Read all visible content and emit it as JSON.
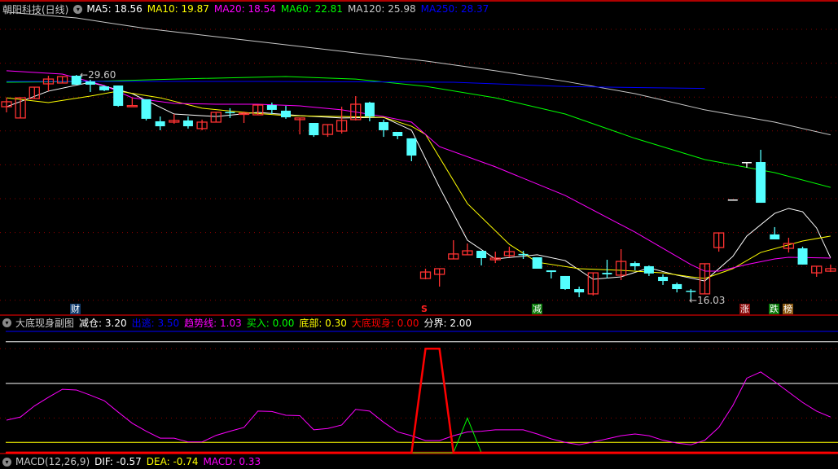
{
  "main": {
    "title": "朝阳科技(日线)",
    "ma_labels": [
      {
        "text": "MA5: 18.56",
        "color": "#ffffff"
      },
      {
        "text": "MA10: 19.87",
        "color": "#ffff00"
      },
      {
        "text": "MA20: 18.54",
        "color": "#ff00ff"
      },
      {
        "text": "MA60: 22.81",
        "color": "#00ff00"
      },
      {
        "text": "MA120: 25.98",
        "color": "#c8c8c8"
      },
      {
        "text": "MA250: 28.37",
        "color": "#0000ff"
      }
    ],
    "high_label": "29.60",
    "low_label": "16.03",
    "markers": {
      "cai": {
        "text": "财",
        "index": 5
      },
      "s": {
        "text": "S",
        "index": 30
      },
      "jian": {
        "text": "减",
        "index": 38
      },
      "zhang": {
        "text": "涨",
        "index": 53
      },
      "die": {
        "text": "跌",
        "index": 55
      },
      "bang": {
        "text": "榜",
        "index": 56
      }
    }
  },
  "sub": {
    "title": "大底现身副图",
    "labels": [
      {
        "text": "减仓: 3.20",
        "color": "#ffffff"
      },
      {
        "text": "出逃: 3.50",
        "color": "#0000ff"
      },
      {
        "text": "趋势线: 1.03",
        "color": "#ff00ff"
      },
      {
        "text": "买入: 0.00",
        "color": "#00ff00"
      },
      {
        "text": "底部: 0.30",
        "color": "#ffff00"
      },
      {
        "text": "大底现身: 0.00",
        "color": "#ff0000"
      },
      {
        "text": "分界: 2.00",
        "color": "#ffffff"
      }
    ]
  },
  "macd": {
    "labels": [
      {
        "text": "MACD(12,26,9)",
        "color": "#c8c8c8"
      },
      {
        "text": "DIF: -0.57",
        "color": "#ffffff"
      },
      {
        "text": "DEA: -0.74",
        "color": "#ffff00"
      },
      {
        "text": "MACD: 0.33",
        "color": "#ff00ff"
      }
    ]
  },
  "colors": {
    "up": "#ff3232",
    "down": "#54ffff",
    "grid": "#8b0000",
    "border": "#b00000"
  },
  "chart_data": {
    "type": "candlestick",
    "candles": [
      [
        27.68,
        28.22,
        27.34,
        27.98
      ],
      [
        27.0,
        28.22,
        27.0,
        28.22
      ],
      [
        28.17,
        28.86,
        28.17,
        28.86
      ],
      [
        29.06,
        29.55,
        28.62,
        29.35
      ],
      [
        29.11,
        29.5,
        29.11,
        29.5
      ],
      [
        29.55,
        29.6,
        29.01,
        29.01
      ],
      [
        29.21,
        29.31,
        28.57,
        29.01
      ],
      [
        28.91,
        28.96,
        28.62,
        28.67
      ],
      [
        28.96,
        28.96,
        27.68,
        27.73
      ],
      [
        27.73,
        28.22,
        27.73,
        27.75
      ],
      [
        28.13,
        28.13,
        26.85,
        26.95
      ],
      [
        26.8,
        27.09,
        26.26,
        26.5
      ],
      [
        26.75,
        27.24,
        26.65,
        26.85
      ],
      [
        26.85,
        27.09,
        26.36,
        26.5
      ],
      [
        26.36,
        26.9,
        26.26,
        26.75
      ],
      [
        26.75,
        27.34,
        26.75,
        27.34
      ],
      [
        27.36,
        27.59,
        27.0,
        27.34
      ],
      [
        27.27,
        27.39,
        26.7,
        27.29
      ],
      [
        27.19,
        27.78,
        27.19,
        27.78
      ],
      [
        27.78,
        27.93,
        27.24,
        27.49
      ],
      [
        27.44,
        27.73,
        26.95,
        27.04
      ],
      [
        26.9,
        27.0,
        26.01,
        27.0
      ],
      [
        26.7,
        26.7,
        25.86,
        25.96
      ],
      [
        26.01,
        26.6,
        25.86,
        26.6
      ],
      [
        26.21,
        27.68,
        26.06,
        26.85
      ],
      [
        26.9,
        28.32,
        26.85,
        27.83
      ],
      [
        27.93,
        27.98,
        26.8,
        27.09
      ],
      [
        26.75,
        26.9,
        25.86,
        26.26
      ],
      [
        26.16,
        26.16,
        25.72,
        25.91
      ],
      [
        25.77,
        25.77,
        24.39,
        24.73
      ],
      [
        17.31,
        17.9,
        17.26,
        17.7
      ],
      [
        17.56,
        17.9,
        16.82,
        17.9
      ],
      [
        18.49,
        19.62,
        18.49,
        18.79
      ],
      [
        18.74,
        19.42,
        18.74,
        18.98
      ],
      [
        18.98,
        18.98,
        18.1,
        18.54
      ],
      [
        18.44,
        18.93,
        18.24,
        18.54
      ],
      [
        18.69,
        19.23,
        18.59,
        18.93
      ],
      [
        18.79,
        18.98,
        18.49,
        18.74
      ],
      [
        18.59,
        18.59,
        17.9,
        17.9
      ],
      [
        17.8,
        17.8,
        17.31,
        17.7
      ],
      [
        17.46,
        17.46,
        16.62,
        16.67
      ],
      [
        16.67,
        16.82,
        16.18,
        16.47
      ],
      [
        16.38,
        17.65,
        16.28,
        17.65
      ],
      [
        17.65,
        18.44,
        17.31,
        17.56
      ],
      [
        17.51,
        19.08,
        17.21,
        18.34
      ],
      [
        18.24,
        18.34,
        17.8,
        18.05
      ],
      [
        18.05,
        18.1,
        17.46,
        17.61
      ],
      [
        17.41,
        17.56,
        16.92,
        17.16
      ],
      [
        16.97,
        17.06,
        16.47,
        16.67
      ],
      [
        16.57,
        16.67,
        16.03,
        16.52
      ],
      [
        16.38,
        18.2,
        16.38,
        18.2
      ],
      [
        19.18,
        20.06,
        18.93,
        20.06
      ],
      [
        22.08,
        22.08,
        22.08,
        22.08
      ],
      [
        24.34,
        24.34,
        24.0,
        24.34
      ],
      [
        24.34,
        25.08,
        21.88,
        21.88
      ],
      [
        19.97,
        20.41,
        19.67,
        19.67
      ],
      [
        19.13,
        19.77,
        18.88,
        19.42
      ],
      [
        19.13,
        19.23,
        18.15,
        18.15
      ],
      [
        17.65,
        18.05,
        17.41,
        18.05
      ],
      [
        17.75,
        18.15,
        17.7,
        17.9
      ]
    ],
    "candle_format": "open,high,low,close",
    "ma": [
      {
        "name": "MA5",
        "color": "#ffffff",
        "points": [
          [
            0,
            27.68
          ],
          [
            3,
            28.62
          ],
          [
            6,
            29.16
          ],
          [
            9,
            28.47
          ],
          [
            12,
            27.24
          ],
          [
            15,
            27.09
          ],
          [
            18,
            27.34
          ],
          [
            21,
            27.14
          ],
          [
            24,
            27.0
          ],
          [
            27,
            27.04
          ],
          [
            29,
            26.26
          ],
          [
            31,
            22.82
          ],
          [
            33,
            19.62
          ],
          [
            35,
            18.49
          ],
          [
            38,
            18.74
          ],
          [
            40,
            18.39
          ],
          [
            42,
            17.26
          ],
          [
            44,
            17.41
          ],
          [
            46,
            17.95
          ],
          [
            48,
            17.51
          ],
          [
            50,
            17.16
          ],
          [
            52,
            18.64
          ],
          [
            53,
            19.87
          ],
          [
            55,
            21.24
          ],
          [
            56,
            21.54
          ],
          [
            57,
            21.34
          ],
          [
            58,
            20.36
          ],
          [
            59,
            18.56
          ]
        ]
      },
      {
        "name": "MA10",
        "color": "#ffff00",
        "points": [
          [
            0,
            28.22
          ],
          [
            3,
            27.93
          ],
          [
            6,
            28.32
          ],
          [
            8,
            28.62
          ],
          [
            11,
            28.22
          ],
          [
            14,
            27.59
          ],
          [
            17,
            27.34
          ],
          [
            20,
            27.14
          ],
          [
            24,
            27.09
          ],
          [
            27,
            27.04
          ],
          [
            29,
            26.5
          ],
          [
            30,
            26.01
          ],
          [
            33,
            21.83
          ],
          [
            36,
            19.37
          ],
          [
            38,
            18.29
          ],
          [
            41,
            17.9
          ],
          [
            44,
            17.8
          ],
          [
            47,
            17.65
          ],
          [
            49,
            17.41
          ],
          [
            50,
            17.31
          ],
          [
            52,
            17.9
          ],
          [
            54,
            18.88
          ],
          [
            57,
            19.57
          ],
          [
            59,
            19.87
          ]
        ]
      },
      {
        "name": "MA20",
        "color": "#ff00ff",
        "points": [
          [
            0,
            29.85
          ],
          [
            4,
            29.65
          ],
          [
            7,
            28.96
          ],
          [
            9,
            28.22
          ],
          [
            12,
            27.88
          ],
          [
            15,
            27.83
          ],
          [
            18,
            27.83
          ],
          [
            21,
            27.73
          ],
          [
            24,
            27.49
          ],
          [
            27,
            27.09
          ],
          [
            29,
            26.75
          ],
          [
            31,
            25.27
          ],
          [
            35,
            24.05
          ],
          [
            40,
            22.32
          ],
          [
            45,
            20.11
          ],
          [
            49,
            18.15
          ],
          [
            50,
            17.75
          ],
          [
            51,
            17.75
          ],
          [
            53,
            18.15
          ],
          [
            55,
            18.49
          ],
          [
            56,
            18.59
          ],
          [
            59,
            18.54
          ]
        ]
      },
      {
        "name": "MA60",
        "color": "#00ff00",
        "points": [
          [
            0,
            29.16
          ],
          [
            6,
            29.2
          ],
          [
            12,
            29.35
          ],
          [
            20,
            29.5
          ],
          [
            25,
            29.35
          ],
          [
            30,
            28.91
          ],
          [
            35,
            28.22
          ],
          [
            40,
            27.24
          ],
          [
            45,
            25.77
          ],
          [
            50,
            24.49
          ],
          [
            55,
            23.7
          ],
          [
            59,
            22.81
          ]
        ]
      },
      {
        "name": "MA120",
        "color": "#c8c8c8",
        "points": [
          [
            0,
            33.39
          ],
          [
            5,
            33.04
          ],
          [
            10,
            32.4
          ],
          [
            20,
            31.42
          ],
          [
            30,
            30.44
          ],
          [
            35,
            29.85
          ],
          [
            40,
            29.21
          ],
          [
            45,
            28.47
          ],
          [
            50,
            27.49
          ],
          [
            55,
            26.75
          ],
          [
            59,
            25.98
          ]
        ]
      },
      {
        "name": "MA250",
        "color": "#0000ff",
        "points": [
          [
            0,
            29.21
          ],
          [
            18,
            29.21
          ],
          [
            32,
            29.16
          ],
          [
            40,
            28.9
          ],
          [
            50,
            28.78
          ]
        ]
      }
    ],
    "sub_series": [
      {
        "name": "趋势线",
        "color": "#ff00ff",
        "start": 0,
        "values": [
          0.94,
          1.03,
          1.35,
          1.6,
          1.83,
          1.81,
          1.66,
          1.5,
          1.17,
          0.85,
          0.62,
          0.42,
          0.42,
          0.31,
          0.31,
          0.5,
          0.62,
          0.73,
          1.2,
          1.19,
          1.08,
          1.07,
          0.66,
          0.7,
          0.8,
          1.25,
          1.2,
          0.88,
          0.6,
          0.49,
          0.35,
          0.35,
          0.49,
          0.6,
          0.62,
          0.66,
          0.66,
          0.66,
          0.54,
          0.4,
          0.3,
          0.23,
          0.31,
          0.4,
          0.49,
          0.54,
          0.49,
          0.36,
          0.28,
          0.23,
          0.36,
          0.73,
          1.36,
          2.15,
          2.33,
          2.05,
          1.75,
          1.45,
          1.2,
          1.03
        ]
      },
      {
        "name": "买入",
        "color": "#00ff00",
        "start": 29,
        "values": [
          0,
          0,
          0,
          0,
          1.0,
          0
        ]
      },
      {
        "name": "大底现身",
        "color": "#ff0000",
        "start": 0,
        "values": [
          0,
          0,
          0,
          0,
          0,
          0,
          0,
          0,
          0,
          0,
          0,
          0,
          0,
          0,
          0,
          0,
          0,
          0,
          0,
          0,
          0,
          0,
          0,
          0,
          0,
          0,
          0,
          0,
          0,
          0,
          3.0,
          3.0,
          0,
          0,
          0,
          0,
          0,
          0,
          0,
          0,
          0,
          0,
          0,
          0,
          0,
          0,
          0,
          0,
          0,
          0,
          0,
          0,
          0,
          0,
          0,
          0,
          0,
          0,
          0,
          0
        ]
      }
    ],
    "sub_levels": [
      {
        "name": "出逃",
        "value": 3.5,
        "color": "#0000ff"
      },
      {
        "name": "减仓",
        "value": 3.2,
        "color": "#ffffff"
      },
      {
        "name": "分界",
        "value": 2.0,
        "color": "#ffffff"
      },
      {
        "name": "底部",
        "value": 0.3,
        "color": "#ffff00"
      }
    ]
  }
}
